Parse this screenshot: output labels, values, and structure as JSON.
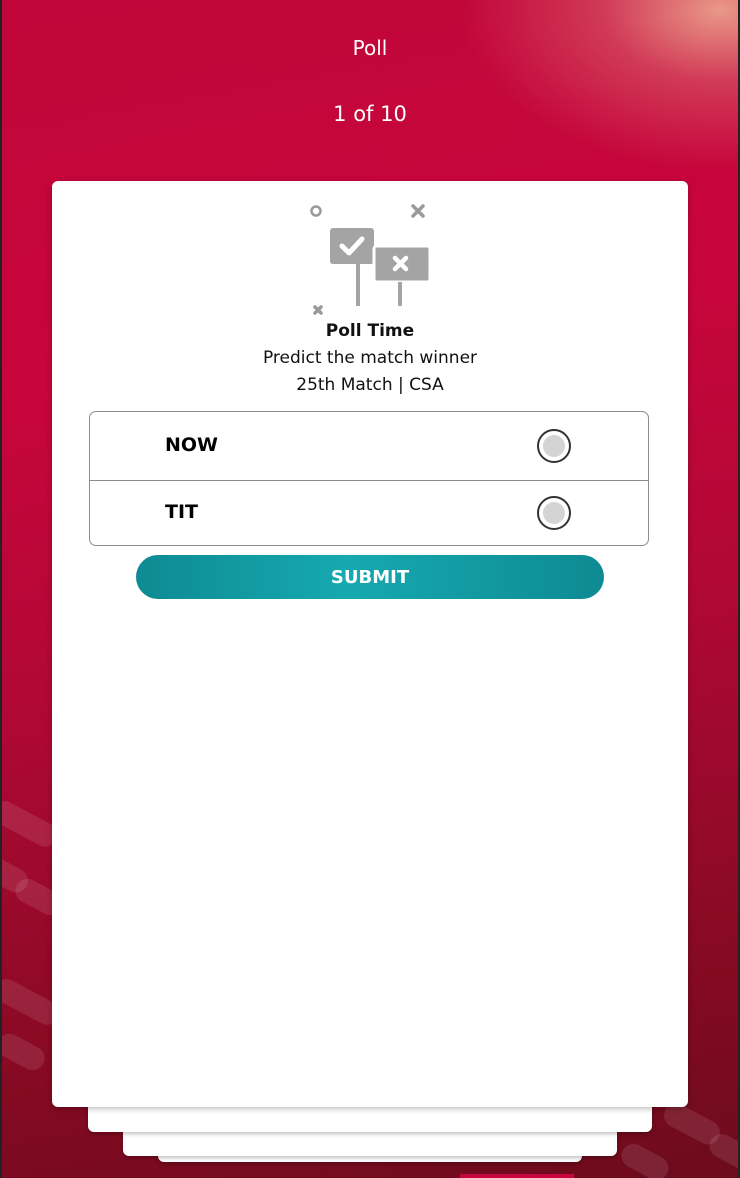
{
  "header": {
    "title": "Poll",
    "counter": "1 of 10"
  },
  "poll": {
    "illustration_icon": "poll-signs-icon",
    "heading": "Poll Time",
    "question": "Predict the match winner",
    "match": "25th Match | CSA",
    "options": [
      {
        "label": "NOW",
        "selected": false
      },
      {
        "label": "TIT",
        "selected": false
      }
    ],
    "submit_label": "SUBMIT"
  },
  "colors": {
    "background_primary": "#c0063a",
    "background_dark": "#6c0b1c",
    "button_accent": "#16a9b0",
    "card": "#ffffff"
  }
}
